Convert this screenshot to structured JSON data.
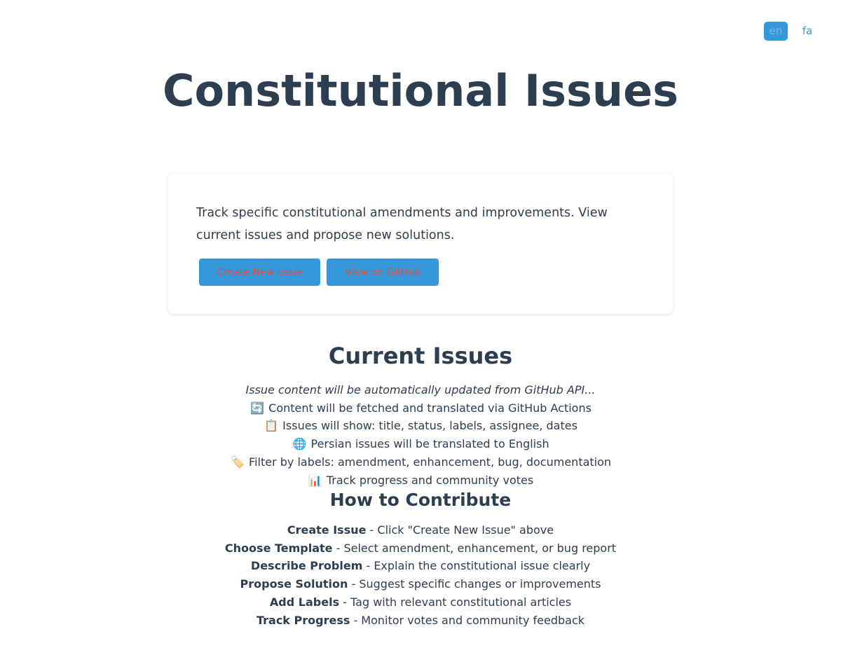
{
  "lang": {
    "en_label": "en",
    "fa_label": "fa"
  },
  "page": {
    "title": "Constitutional Issues"
  },
  "intro": {
    "text": "Track specific constitutional amendments and improvements. View current issues and propose new solutions.",
    "create_button": "Create New Issue",
    "github_button": "View on GitHub"
  },
  "current": {
    "title": "Current Issues",
    "note": "Issue content will be automatically updated from GitHub API...",
    "items": [
      {
        "icon": "refresh-icon",
        "glyph": "🔄",
        "text": "Content will be fetched and translated via GitHub Actions"
      },
      {
        "icon": "clipboard-icon",
        "glyph": "📋",
        "text": "Issues will show: title, status, labels, assignee, dates"
      },
      {
        "icon": "globe-icon",
        "glyph": "🌐",
        "text": "Persian issues will be translated to English"
      },
      {
        "icon": "label-tag-icon",
        "glyph": "🏷️",
        "text": "Filter by labels: amendment, enhancement, bug, documentation"
      },
      {
        "icon": "bar-chart-icon",
        "glyph": "📊",
        "text": "Track progress and community votes"
      }
    ]
  },
  "contribute": {
    "title": "How to Contribute",
    "steps": [
      {
        "name": "Create Issue",
        "desc": " - Click \"Create New Issue\" above"
      },
      {
        "name": "Choose Template",
        "desc": " - Select amendment, enhancement, or bug report"
      },
      {
        "name": "Describe Problem",
        "desc": " - Explain the constitutional issue clearly"
      },
      {
        "name": "Propose Solution",
        "desc": " - Suggest specific changes or improvements"
      },
      {
        "name": "Add Labels",
        "desc": " - Tag with relevant constitutional articles"
      },
      {
        "name": "Track Progress",
        "desc": " - Monitor votes and community feedback"
      }
    ]
  },
  "colors": {
    "heading": "#2c3e50",
    "accent": "#3498db",
    "button_text": "#e74c3c"
  }
}
